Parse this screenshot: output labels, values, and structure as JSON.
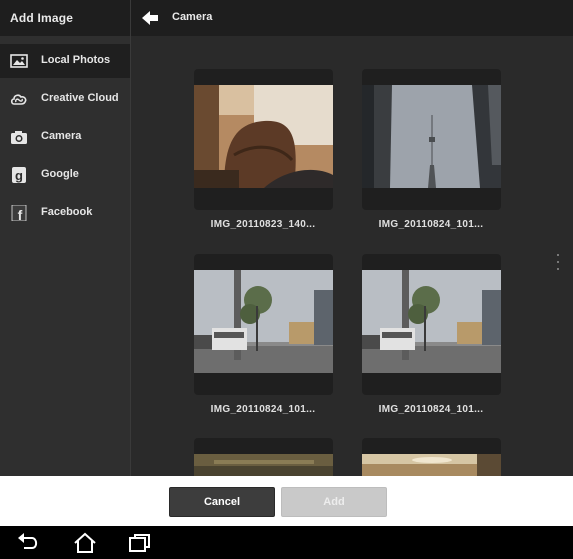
{
  "header": {
    "title": "Add Image",
    "breadcrumb": "Camera"
  },
  "sidebar": {
    "items": [
      {
        "label": "Local Photos",
        "icon": "photo-icon",
        "active": true
      },
      {
        "label": "Creative Cloud",
        "icon": "creative-cloud-icon",
        "active": false
      },
      {
        "label": "Camera",
        "icon": "camera-icon",
        "active": false
      },
      {
        "label": "Google",
        "icon": "google-plus-icon",
        "active": false
      },
      {
        "label": "Facebook",
        "icon": "facebook-icon",
        "active": false
      }
    ]
  },
  "photos": [
    {
      "caption": "IMG_20110823_140..."
    },
    {
      "caption": "IMG_20110824_101..."
    },
    {
      "caption": "IMG_20110824_101..."
    },
    {
      "caption": "IMG_20110824_101..."
    },
    {
      "caption": ""
    },
    {
      "caption": ""
    }
  ],
  "footer": {
    "cancel_label": "Cancel",
    "add_label": "Add"
  },
  "navbar": {
    "icons": [
      "back-icon",
      "home-icon",
      "recent-apps-icon"
    ]
  },
  "colors": {
    "background": "#2b2b2b",
    "topbar": "#1e1e1e",
    "active_item": "#1f1f1f",
    "cancel_button": "#3d3d3d",
    "add_button_disabled": "#c9c9c9"
  }
}
